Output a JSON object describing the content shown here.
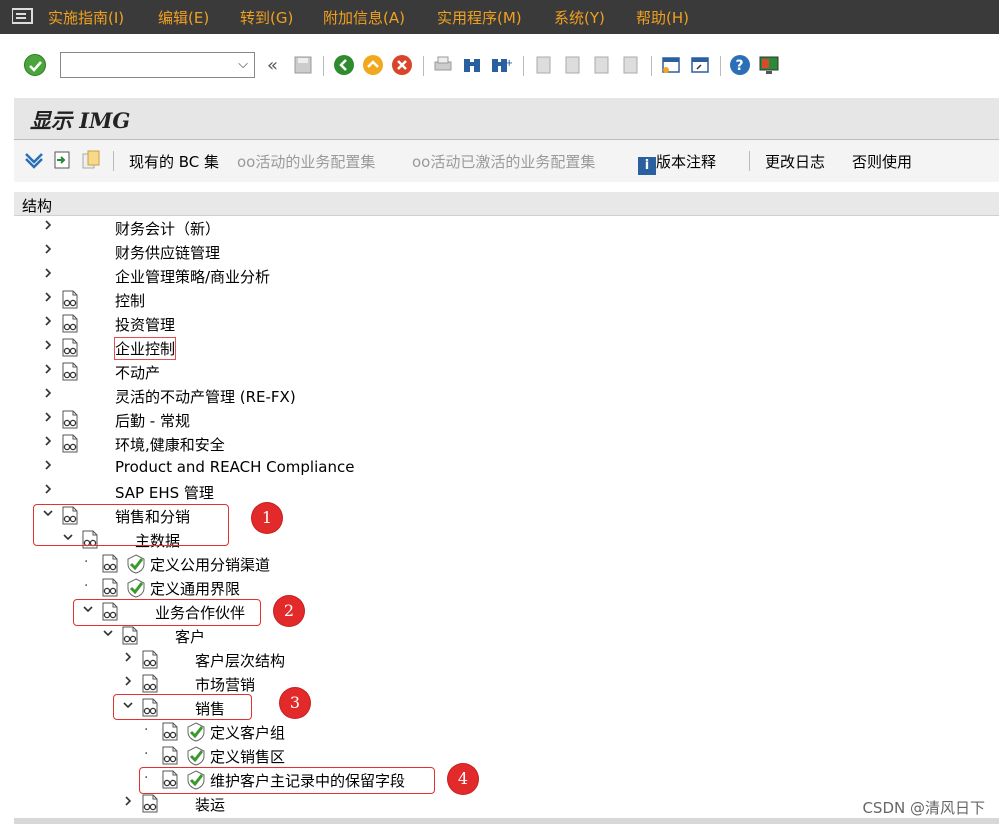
{
  "menubar": {
    "items": [
      "实施指南(I)",
      "编辑(E)",
      "转到(G)",
      "附加信息(A)",
      "实用程序(M)",
      "系统(Y)",
      "帮助(H)"
    ]
  },
  "toolbar": {
    "command_value": "",
    "icons": [
      "ok-icon",
      "back-double-icon",
      "save-icon",
      "back-icon",
      "exit-icon",
      "cancel-icon",
      "print-icon",
      "find-icon",
      "find-next-icon",
      "first-page-icon",
      "previous-page-icon",
      "next-page-icon",
      "last-page-icon",
      "new-session-icon",
      "shortcut-icon",
      "help-icon",
      "layout-icon"
    ]
  },
  "title": "显示 IMG",
  "app_toolbar": {
    "bc_set": "现有的 BC 集",
    "active_bc": "活动的业务配置集",
    "activated_bc": "活动已激活的业务配置集",
    "release_notes": "版本注释",
    "change_log": "更改日志",
    "usage": "否则使用"
  },
  "structure_header": "结构",
  "tree": [
    {
      "label": "财务会计（新）",
      "level": 0,
      "expand": "closed",
      "icon": false,
      "check": false
    },
    {
      "label": "财务供应链管理",
      "level": 0,
      "expand": "closed",
      "icon": false,
      "check": false
    },
    {
      "label": "企业管理策略/商业分析",
      "level": 0,
      "expand": "closed",
      "icon": false,
      "check": false
    },
    {
      "label": "控制",
      "level": 0,
      "expand": "closed",
      "icon": true,
      "check": false
    },
    {
      "label": "投资管理",
      "level": 0,
      "expand": "closed",
      "icon": true,
      "check": false
    },
    {
      "label": "企业控制",
      "level": 0,
      "expand": "closed",
      "icon": true,
      "check": false,
      "boxed": true
    },
    {
      "label": "不动产",
      "level": 0,
      "expand": "closed",
      "icon": true,
      "check": false
    },
    {
      "label": "灵活的不动产管理 (RE-FX)",
      "level": 0,
      "expand": "closed",
      "icon": false,
      "check": false
    },
    {
      "label": "后勤 - 常规",
      "level": 0,
      "expand": "closed",
      "icon": true,
      "check": false
    },
    {
      "label": "环境,健康和安全",
      "level": 0,
      "expand": "closed",
      "icon": true,
      "check": false
    },
    {
      "label": "Product and REACH Compliance",
      "level": 0,
      "expand": "closed",
      "icon": false,
      "check": false
    },
    {
      "label": "SAP EHS 管理",
      "level": 0,
      "expand": "closed",
      "icon": false,
      "check": false
    },
    {
      "label": "销售和分销",
      "level": 0,
      "expand": "open",
      "icon": true,
      "check": false
    },
    {
      "label": "主数据",
      "level": 1,
      "expand": "open",
      "icon": true,
      "check": false
    },
    {
      "label": "定义公用分销渠道",
      "level": 2,
      "expand": "leaf",
      "icon": true,
      "check": true
    },
    {
      "label": "定义通用界限",
      "level": 2,
      "expand": "leaf",
      "icon": true,
      "check": true
    },
    {
      "label": "业务合作伙伴",
      "level": 2,
      "expand": "open",
      "icon": true,
      "check": false
    },
    {
      "label": "客户",
      "level": 3,
      "expand": "open",
      "icon": true,
      "check": false
    },
    {
      "label": "客户层次结构",
      "level": 4,
      "expand": "closed",
      "icon": true,
      "check": false
    },
    {
      "label": "市场营销",
      "level": 4,
      "expand": "closed",
      "icon": true,
      "check": false
    },
    {
      "label": "销售",
      "level": 4,
      "expand": "open",
      "icon": true,
      "check": false
    },
    {
      "label": "定义客户组",
      "level": 5,
      "expand": "leaf",
      "icon": true,
      "check": true
    },
    {
      "label": "定义销售区",
      "level": 5,
      "expand": "leaf",
      "icon": true,
      "check": true
    },
    {
      "label": "维护客户主记录中的保留字段",
      "level": 5,
      "expand": "leaf",
      "icon": true,
      "check": true
    },
    {
      "label": "装运",
      "level": 4,
      "expand": "closed",
      "icon": true,
      "check": false
    }
  ],
  "annotations": [
    "1",
    "2",
    "3",
    "4"
  ],
  "watermark": "CSDN @清风日下"
}
